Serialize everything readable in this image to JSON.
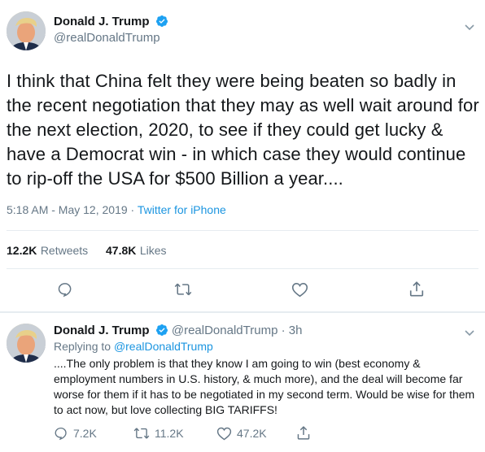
{
  "main_tweet": {
    "author_name": "Donald J. Trump",
    "author_handle": "@realDonaldTrump",
    "text": "I think that China felt they were being beaten so badly in the recent negotiation that they may as well wait around for the next election, 2020, to see if they could get lucky & have a Democrat win - in which case they would continue to rip-off the USA for $500 Billion a year....",
    "time": "5:18 AM - May 12, 2019",
    "separator": "·",
    "source": "Twitter for iPhone",
    "retweets_count": "12.2K",
    "retweets_label": "Retweets",
    "likes_count": "47.8K",
    "likes_label": "Likes"
  },
  "reply_tweet": {
    "author_name": "Donald J. Trump",
    "author_handle": "@realDonaldTrump",
    "age": "3h",
    "separator": "·",
    "replying_to_label": "Replying to",
    "replying_to_handle": "@realDonaldTrump",
    "text": "....The only problem is that they know I am going to win (best economy & employment numbers in U.S. history, & much more), and the deal will become far worse for them if it has to be negotiated in my second term. Would be wise for them to act now, but love collecting BIG TARIFFS!",
    "reply_count": "7.2K",
    "retweet_count": "11.2K",
    "like_count": "47.2K"
  },
  "icons": [
    "chevron-down-icon",
    "verified-icon",
    "reply-icon",
    "retweet-icon",
    "like-icon",
    "share-icon"
  ],
  "colors": {
    "link": "#1b95e0",
    "muted": "#657786",
    "divider": "#e6ecf0",
    "verified": "#1da1f2"
  }
}
